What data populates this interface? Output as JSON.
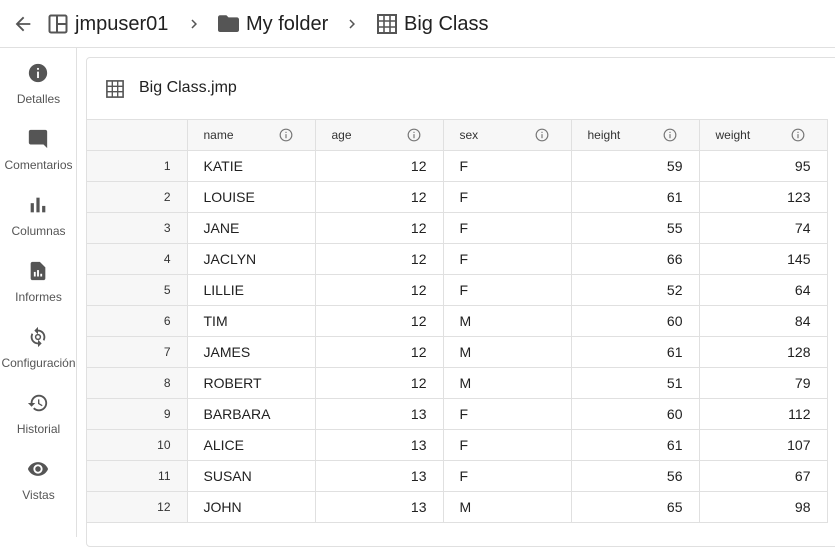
{
  "breadcrumb": {
    "items": [
      {
        "label": "jmpuser01",
        "icon": "workspace-icon"
      },
      {
        "label": "My folder",
        "icon": "folder-icon"
      },
      {
        "label": "Big Class",
        "icon": "table-icon"
      }
    ]
  },
  "sidebar": {
    "items": [
      {
        "label": "Detalles",
        "icon": "info-icon"
      },
      {
        "label": "Comentarios",
        "icon": "comment-icon"
      },
      {
        "label": "Columnas",
        "icon": "bar-chart-icon"
      },
      {
        "label": "Informes",
        "icon": "report-icon"
      },
      {
        "label": "Configuración",
        "icon": "settings-sync-icon"
      },
      {
        "label": "Historial",
        "icon": "history-icon"
      },
      {
        "label": "Vistas",
        "icon": "eye-icon"
      }
    ]
  },
  "card": {
    "title": "Big Class.jmp"
  },
  "table": {
    "columns": [
      "name",
      "age",
      "sex",
      "height",
      "weight"
    ],
    "rows": [
      {
        "n": "1",
        "name": "KATIE",
        "age": "12",
        "sex": "F",
        "height": "59",
        "weight": "95"
      },
      {
        "n": "2",
        "name": "LOUISE",
        "age": "12",
        "sex": "F",
        "height": "61",
        "weight": "123"
      },
      {
        "n": "3",
        "name": "JANE",
        "age": "12",
        "sex": "F",
        "height": "55",
        "weight": "74"
      },
      {
        "n": "4",
        "name": "JACLYN",
        "age": "12",
        "sex": "F",
        "height": "66",
        "weight": "145"
      },
      {
        "n": "5",
        "name": "LILLIE",
        "age": "12",
        "sex": "F",
        "height": "52",
        "weight": "64"
      },
      {
        "n": "6",
        "name": "TIM",
        "age": "12",
        "sex": "M",
        "height": "60",
        "weight": "84"
      },
      {
        "n": "7",
        "name": "JAMES",
        "age": "12",
        "sex": "M",
        "height": "61",
        "weight": "128"
      },
      {
        "n": "8",
        "name": "ROBERT",
        "age": "12",
        "sex": "M",
        "height": "51",
        "weight": "79"
      },
      {
        "n": "9",
        "name": "BARBARA",
        "age": "13",
        "sex": "F",
        "height": "60",
        "weight": "112"
      },
      {
        "n": "10",
        "name": "ALICE",
        "age": "13",
        "sex": "F",
        "height": "61",
        "weight": "107"
      },
      {
        "n": "11",
        "name": "SUSAN",
        "age": "13",
        "sex": "F",
        "height": "56",
        "weight": "67"
      },
      {
        "n": "12",
        "name": "JOHN",
        "age": "13",
        "sex": "M",
        "height": "65",
        "weight": "98"
      }
    ]
  }
}
